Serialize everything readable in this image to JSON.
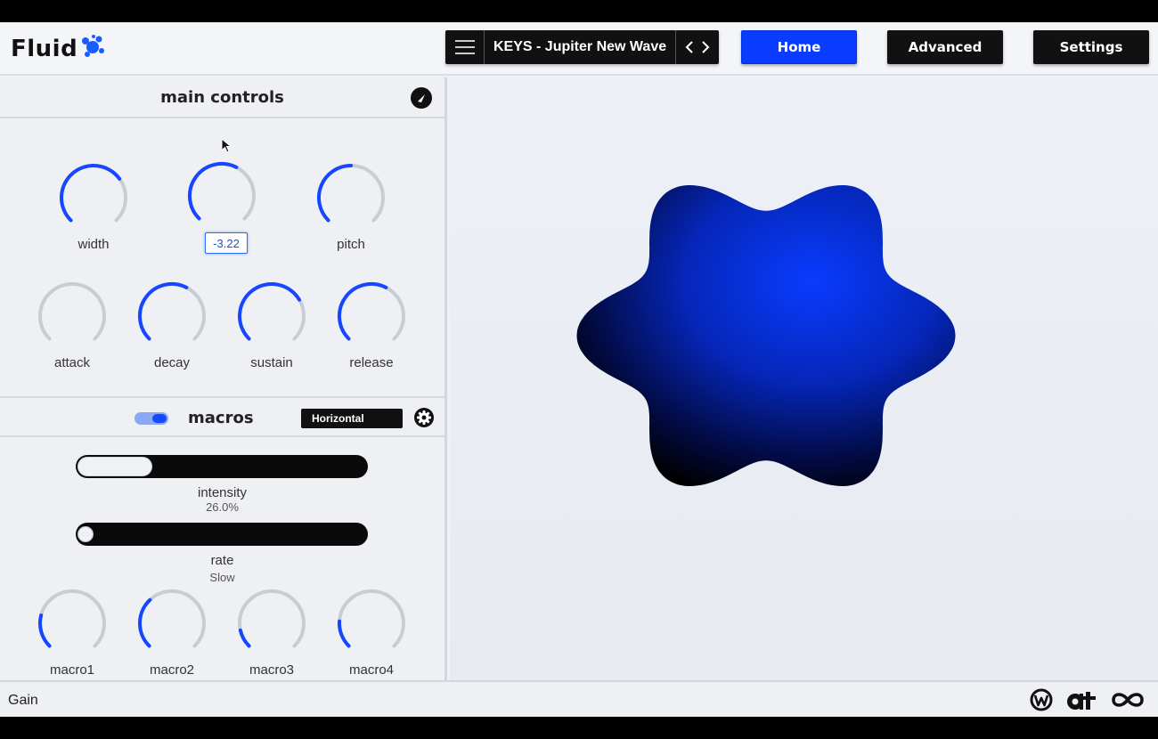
{
  "app": {
    "logo_text": "Fluid"
  },
  "preset": {
    "name": "KEYS - Jupiter New Wave"
  },
  "nav": {
    "home": "Home",
    "advanced": "Advanced",
    "settings": "Settings"
  },
  "main_controls": {
    "title": "main controls",
    "value_readout": "-3.22",
    "knobs": [
      {
        "label": "width",
        "value": 0.7
      },
      {
        "label": "",
        "value": 0.6
      },
      {
        "label": "pitch",
        "value": 0.5
      },
      {
        "label": "attack",
        "value": 0.0
      },
      {
        "label": "decay",
        "value": 0.6
      },
      {
        "label": "sustain",
        "value": 0.72
      },
      {
        "label": "release",
        "value": 0.6
      }
    ]
  },
  "macros": {
    "title": "macros",
    "orientation": "Horizontal",
    "intensity": {
      "label": "intensity",
      "value_text": "26.0%",
      "value": 0.26
    },
    "rate": {
      "label": "rate",
      "value_text": "Slow",
      "value": 0.0
    },
    "knobs": [
      {
        "label": "macro1",
        "value": 0.22
      },
      {
        "label": "macro2",
        "value": 0.34
      },
      {
        "label": "macro3",
        "value": 0.12
      },
      {
        "label": "macro4",
        "value": 0.18
      }
    ]
  },
  "footer": {
    "gain_label": "Gain"
  },
  "colors": {
    "accent": "#1646ff",
    "home_button": "#0a3cff",
    "dark": "#111111",
    "track": "#c8ccd3"
  }
}
